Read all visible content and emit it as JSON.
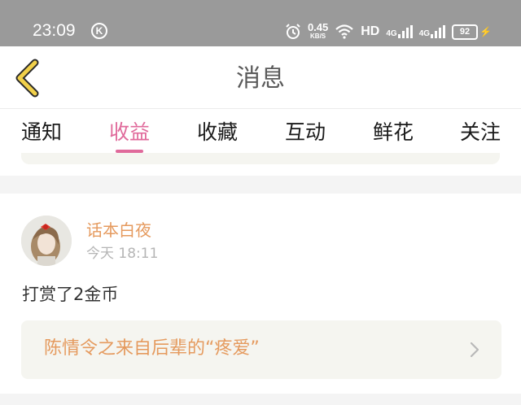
{
  "status_bar": {
    "time": "23:09",
    "k_badge": "K",
    "net_speed_value": "0.45",
    "net_speed_unit": "KB/S",
    "hd_label": "HD",
    "net_type_1": "4G",
    "net_type_2": "4G",
    "battery_level": "92"
  },
  "header": {
    "title": "消息"
  },
  "tabs": [
    {
      "label": "通知"
    },
    {
      "label": "收益"
    },
    {
      "label": "收藏"
    },
    {
      "label": "互动"
    },
    {
      "label": "鲜花"
    },
    {
      "label": "关注"
    }
  ],
  "active_tab": "收益",
  "notification": {
    "username": "话本白夜",
    "timestamp": "今天 18:11",
    "message": "打赏了2金币",
    "book_link": "陈情令之来自后辈的“疼爱”"
  },
  "colors": {
    "accent_pink": "#e06a9b",
    "accent_orange": "#e59a5e",
    "back_arrow_yellow": "#f1d04a",
    "battery_charging_green": "#3cc63c"
  }
}
